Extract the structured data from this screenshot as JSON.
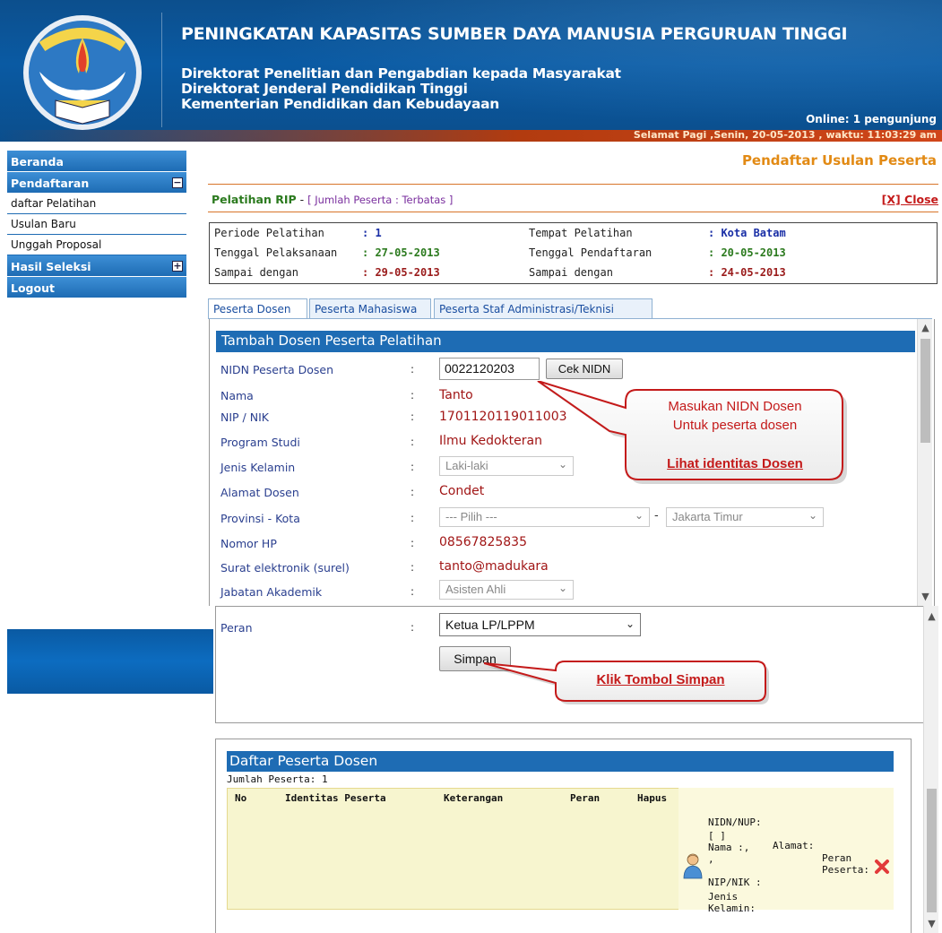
{
  "header": {
    "title": "PENINGKATAN KAPASITAS SUMBER DAYA MANUSIA PERGURUAN TINGGI",
    "line1": "Direktorat Penelitian dan Pengabdian kepada Masyarakat",
    "line2": "Direktorat Jenderal Pendidikan Tinggi",
    "line3": "Kementerian Pendidikan dan Kebudayaan",
    "online": "Online: 1 pengunjung",
    "greeting": "Selamat Pagi ,Senin, 20-05-2013 , waktu: 11:03:29 am",
    "logo_text": "TUT WURI HANDAYANI"
  },
  "sidebar": {
    "items": [
      {
        "label": "Beranda"
      },
      {
        "label": "Pendaftaran",
        "toggle": "−"
      },
      {
        "label": "daftar Pelatihan"
      },
      {
        "label": "Usulan Baru"
      },
      {
        "label": "Unggah Proposal"
      },
      {
        "label": "Hasil Seleksi",
        "toggle": "+"
      },
      {
        "label": "Logout"
      }
    ]
  },
  "page": {
    "heading": "Pendaftar Usulan Peserta",
    "pelatihan_name": "Pelatihan RIP",
    "pelatihan_sep": " - ",
    "jumlah": "[ Jumlah Peserta : Terbatas ]",
    "close": "[X] Close"
  },
  "info": {
    "periode_label": "Periode Pelatihan",
    "periode_value": ": 1",
    "tgl_pelaksanaan_label": "Tenggal Pelaksanaan",
    "tgl_pelaksanaan_value": ": 27-05-2013",
    "sampai1_label": "Sampai dengan",
    "sampai1_value": ": 29-05-2013",
    "tempat_label": "Tempat Pelatihan",
    "tempat_value": ": Kota Batam",
    "tgl_pendaftaran_label": "Tenggal Pendaftaran",
    "tgl_pendaftaran_value": ": 20-05-2013",
    "sampai2_label": "Sampai dengan",
    "sampai2_value": ": 24-05-2013"
  },
  "tabs": [
    {
      "label": "Peserta Dosen",
      "active": true
    },
    {
      "label": "Peserta Mahasiswa"
    },
    {
      "label": "Peserta Staf Administrasi/Teknisi"
    }
  ],
  "form": {
    "section_title": "Tambah Dosen Peserta Pelatihan",
    "colon": ":",
    "nidn_label": "NIDN Peserta Dosen",
    "nidn_value": "0022120203",
    "cek_button": "Cek NIDN",
    "nama_label": "Nama",
    "nama_value": "Tanto",
    "nip_label": "NIP / NIK",
    "nip_value": "1701120119011003",
    "prodi_label": "Program Studi",
    "prodi_value": "Ilmu Kedokteran",
    "jk_label": "Jenis Kelamin",
    "jk_value": "Laki-laki",
    "alamat_label": "Alamat Dosen",
    "alamat_value": "Condet",
    "provinsi_label": "Provinsi - Kota",
    "provinsi_value": "--- Pilih ---",
    "provinsi_sep": "-",
    "kota_value": "Jakarta Timur",
    "hp_label": "Nomor HP",
    "hp_value": "08567825835",
    "email_label": "Surat elektronik (surel)",
    "email_value": "tanto@madukara",
    "jabatan_label": "Jabatan Akademik",
    "jabatan_value": "Asisten Ahli",
    "peran_label": "Peran",
    "peran_value": "Ketua LP/LPPM",
    "simpan_button": "Simpan"
  },
  "callouts": {
    "nidn_line1": "Masukan NIDN Dosen",
    "nidn_line2": "Untuk peserta dosen",
    "nidn_link": "Lihat identitas Dosen",
    "simpan": "Klik Tombol Simpan"
  },
  "list": {
    "title": "Daftar Peserta Dosen",
    "jumlah": "Jumlah Peserta: 1",
    "columns": [
      "No",
      "Identitas Peserta",
      "Keterangan",
      "Peran",
      "Hapus"
    ],
    "row": {
      "nidn_label": "NIDN/NUP:",
      "nidn_bracket": "[ ]",
      "nama": "Nama :,",
      "comma": ",",
      "nip": "NIP/NIK :",
      "jenis": "Jenis",
      "kelamin": "Kelamin:",
      "alamat": "Alamat:",
      "peran1": "Peran",
      "peran2": "Peserta:"
    }
  },
  "colors": {
    "header_blue": "#0a5aa3",
    "accent_orange": "#e28a14",
    "value_red": "#a11616",
    "label_blue": "#2a3f8f"
  }
}
